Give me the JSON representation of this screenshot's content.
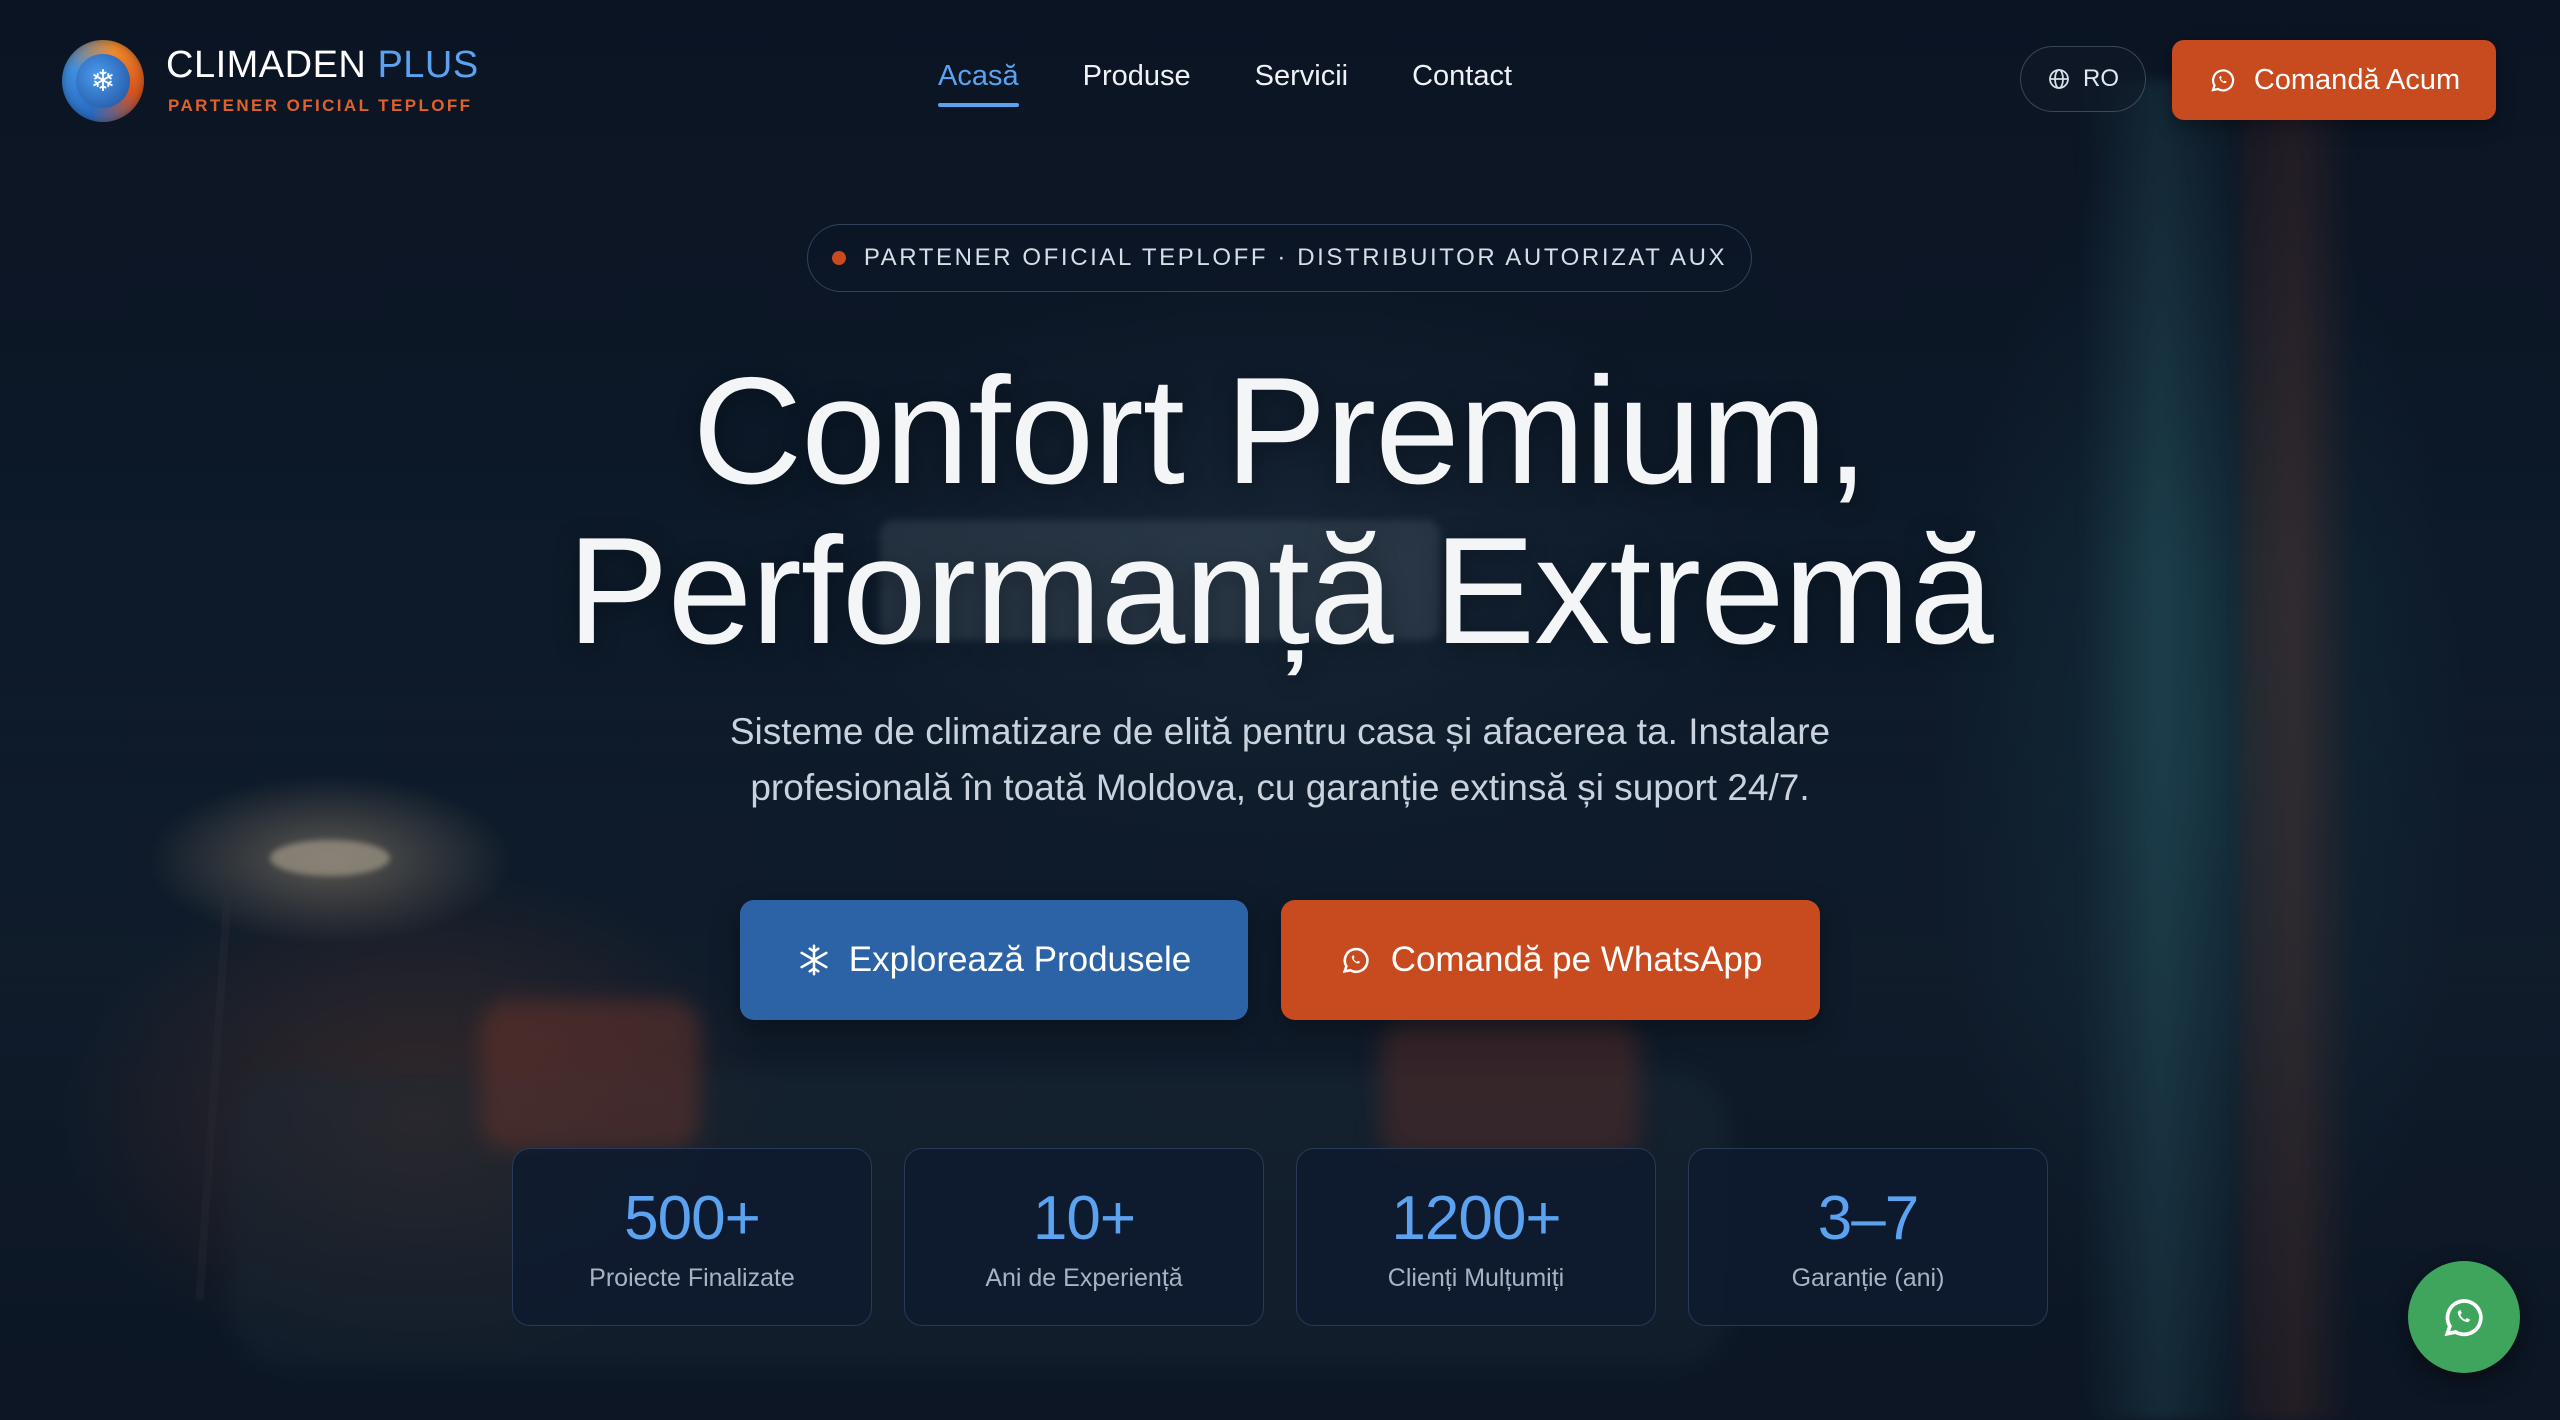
{
  "header": {
    "brand_main": "CLIMADEN",
    "brand_accent": "PLUS",
    "tagline": "PARTENER OFICIAL TEPLOFF",
    "logo_icon": "snowflake-flame-logo",
    "nav": [
      {
        "label": "Acasă",
        "active": true
      },
      {
        "label": "Produse",
        "active": false
      },
      {
        "label": "Servicii",
        "active": false
      },
      {
        "label": "Contact",
        "active": false
      }
    ],
    "language": "RO",
    "cta_label": "Comandă Acum"
  },
  "hero": {
    "badge": "PARTENER OFICIAL TEPLOFF · DISTRIBUITOR AUTORIZAT AUX",
    "title_line1": "Confort Premium,",
    "title_line2": "Performanță Extremă",
    "subtitle": "Sisteme de climatizare de elită pentru casa și afacerea ta. Instalare profesională în toată Moldova, cu garanție extinsă și suport 24/7.",
    "primary_button": "Explorează Produsele",
    "secondary_button": "Comandă pe WhatsApp"
  },
  "stats": [
    {
      "value": "500+",
      "label": "Proiecte Finalizate"
    },
    {
      "value": "10+",
      "label": "Ani de Experiență"
    },
    {
      "value": "1200+",
      "label": "Clienți Mulțumiți"
    },
    {
      "value": "3–7",
      "label": "Garanție (ani)"
    }
  ],
  "colors": {
    "accent_blue": "#5ba2f0",
    "button_blue": "#2c63a6",
    "accent_orange": "#c84a1f",
    "whatsapp_green": "#3fa55c",
    "background": "#0b1626"
  },
  "icons": {
    "language": "globe-icon",
    "cta": "whatsapp-icon",
    "primary_button": "snowflake-icon",
    "floating": "whatsapp-icon"
  }
}
